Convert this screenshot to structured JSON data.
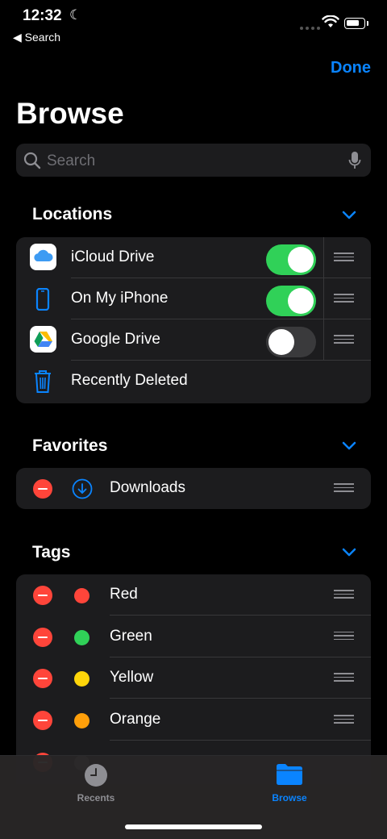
{
  "status": {
    "time": "12:32",
    "back_label": "Search"
  },
  "nav": {
    "done_label": "Done",
    "title": "Browse"
  },
  "search": {
    "placeholder": "Search"
  },
  "sections": {
    "locations": "Locations",
    "favorites": "Favorites",
    "tags": "Tags"
  },
  "locations": [
    {
      "label": "iCloud Drive",
      "icon": "icloud-icon",
      "enabled": true
    },
    {
      "label": "On My iPhone",
      "icon": "iphone-icon",
      "enabled": true
    },
    {
      "label": "Google Drive",
      "icon": "google-drive-icon",
      "enabled": false
    },
    {
      "label": "Recently Deleted",
      "icon": "trash-icon"
    }
  ],
  "favorites": [
    {
      "label": "Downloads",
      "icon": "download-icon"
    }
  ],
  "tags": [
    {
      "label": "Red",
      "color": "#ff453a"
    },
    {
      "label": "Green",
      "color": "#30d158"
    },
    {
      "label": "Yellow",
      "color": "#ffd60a"
    },
    {
      "label": "Orange",
      "color": "#ff9f0a"
    }
  ],
  "colors": {
    "accent": "#0a84ff",
    "toggle_on": "#30d158",
    "delete": "#ff453a"
  },
  "tabbar": {
    "recents_label": "Recents",
    "browse_label": "Browse",
    "selected": "Browse"
  }
}
